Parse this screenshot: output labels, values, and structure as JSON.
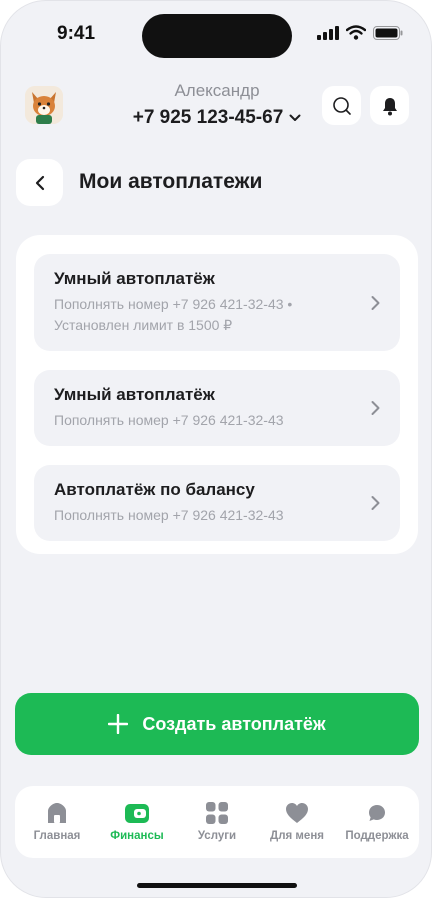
{
  "status_bar": {
    "time": "9:41",
    "signal_icon": "cellular-signal-icon",
    "wifi_icon": "wifi-icon",
    "battery_icon": "battery-icon"
  },
  "header": {
    "user_name": "Александр",
    "user_phone": "+7 925 123-45-67",
    "search_icon": "search-icon",
    "notifications_icon": "bell-icon"
  },
  "page": {
    "title": "Мои автоплатежи",
    "back_icon": "chevron-left-icon"
  },
  "autopayments": [
    {
      "title": "Умный автоплатёж",
      "subtitle_lines": [
        "Пополнять номер +7 926 421-32-43 •",
        "Установлен лимит в 1500 ₽"
      ]
    },
    {
      "title": "Умный автоплатёж",
      "subtitle_lines": [
        "Пополнять номер +7 926 421-32-43"
      ]
    },
    {
      "title": "Автоплатёж по балансу",
      "subtitle_lines": [
        "Пополнять номер +7 926 421-32-43"
      ]
    }
  ],
  "create_button": {
    "label": "Создать автоплатёж",
    "icon": "plus-icon"
  },
  "tabbar": {
    "active": "finances",
    "tabs": [
      {
        "id": "home",
        "label": "Главная",
        "icon": "home-icon"
      },
      {
        "id": "finances",
        "label": "Финансы",
        "icon": "wallet-icon"
      },
      {
        "id": "services",
        "label": "Услуги",
        "icon": "grid-icon"
      },
      {
        "id": "for-me",
        "label": "Для меня",
        "icon": "heart-icon"
      },
      {
        "id": "support",
        "label": "Поддержка",
        "icon": "chat-bubble-icon"
      }
    ]
  },
  "colors": {
    "accent": "#1dba55",
    "background": "#f1f2f6",
    "inactive": "#8d8f96"
  }
}
